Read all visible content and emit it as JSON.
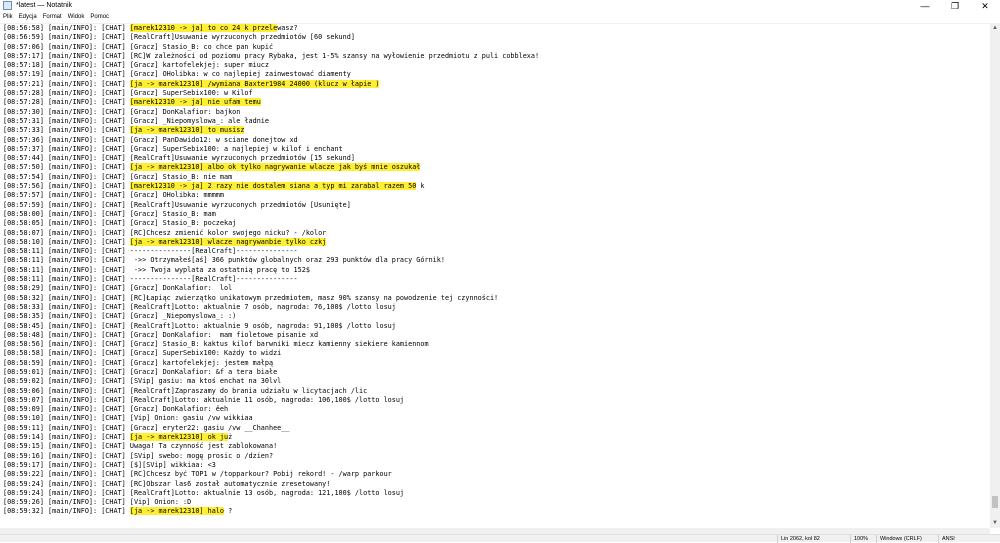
{
  "window": {
    "title": "*latest — Notatnik",
    "minimize_glyph": "—",
    "maximize_glyph": "❐",
    "close_glyph": "✕"
  },
  "menu": [
    "Plik",
    "Edycja",
    "Format",
    "Widok",
    "Pomoc"
  ],
  "lines": [
    {
      "pre": "[08:56:58] [main/INFO]: [CHAT] ",
      "hl": "[marek12310 -> ja] to co 24 k przele",
      "post": "wasz?"
    },
    {
      "pre": "[08:56:59] [main/INFO]: [CHAT] [RealCraft]Usuwanie wyrzuconych przedmiotów [60 sekund]",
      "hl": "",
      "post": ""
    },
    {
      "pre": "[08:57:06] [main/INFO]: [CHAT] [Gracz] Stasio_B: co chce pan kupić",
      "hl": "",
      "post": ""
    },
    {
      "pre": "[08:57:17] [main/INFO]: [CHAT] [RC]W zależności od poziomu pracy Rybaka, jest 1-5% szansy na wyłowienie przedmiotu z puli cobblexa!",
      "hl": "",
      "post": ""
    },
    {
      "pre": "[08:57:18] [main/INFO]: [CHAT] [Gracz] kartofelekjej: super miucz",
      "hl": "",
      "post": ""
    },
    {
      "pre": "[08:57:19] [main/INFO]: [CHAT] [Gracz] OHolibka: w co najlepiej zainwestować diamenty",
      "hl": "",
      "post": ""
    },
    {
      "pre": "[08:57:21] [main/INFO]: [CHAT] ",
      "hl": "[ja -> marek12310] /wymiana Baxter1984 24000 (klucz w łapie )",
      "post": ""
    },
    {
      "pre": "[08:57:28] [main/INFO]: [CHAT] [Gracz] SuperSebix100: w Kilof",
      "hl": "",
      "post": ""
    },
    {
      "pre": "[08:57:28] [main/INFO]: [CHAT] ",
      "hl": "[marek12310 -> ja] nie ufam temu",
      "post": ""
    },
    {
      "pre": "[08:57:30] [main/INFO]: [CHAT] [Gracz] DonKalafior: bajkon",
      "hl": "",
      "post": ""
    },
    {
      "pre": "[08:57:31] [main/INFO]: [CHAT] [Gracz] _Niepomyslowa_: ale ładnie",
      "hl": "",
      "post": ""
    },
    {
      "pre": "[08:57:33] [main/INFO]: [CHAT] ",
      "hl": "[ja -> marek12310] to musisz",
      "post": ""
    },
    {
      "pre": "[08:57:36] [main/INFO]: [CHAT] [Gracz] PanDawido12: w sciane donejtow xd",
      "hl": "",
      "post": ""
    },
    {
      "pre": "[08:57:37] [main/INFO]: [CHAT] [Gracz] SuperSebix100: a najlepiej w kilof i enchant",
      "hl": "",
      "post": ""
    },
    {
      "pre": "[08:57:44] [main/INFO]: [CHAT] [RealCraft]Usuwanie wyrzuconych przedmiotów [15 sekund]",
      "hl": "",
      "post": ""
    },
    {
      "pre": "[08:57:50] [main/INFO]: [CHAT] ",
      "hl": "[ja -> marek12310] albo ok tylko nagrywanie wlacze jak byś mnie oszukał",
      "post": ""
    },
    {
      "pre": "[08:57:54] [main/INFO]: [CHAT] [Gracz] Stasio_B: nie mam",
      "hl": "",
      "post": ""
    },
    {
      "pre": "[08:57:56] [main/INFO]: [CHAT] ",
      "hl": "[marek12310 -> ja] 2 razy nie dostalem siana a typ mi zarabal razem 50",
      "post": " k"
    },
    {
      "pre": "[08:57:57] [main/INFO]: [CHAT] [Gracz] OHolibka: mmmmm",
      "hl": "",
      "post": ""
    },
    {
      "pre": "[08:57:59] [main/INFO]: [CHAT] [RealCraft]Usuwanie wyrzuconych przedmiotów [Usunięte]",
      "hl": "",
      "post": ""
    },
    {
      "pre": "[08:58:00] [main/INFO]: [CHAT] [Gracz] Stasio_B: mam",
      "hl": "",
      "post": ""
    },
    {
      "pre": "[08:58:05] [main/INFO]: [CHAT] [Gracz] Stasio_B: poczekaj",
      "hl": "",
      "post": ""
    },
    {
      "pre": "[08:58:07] [main/INFO]: [CHAT] [RC]Chcesz zmienić kolor swojego nicku? - /kolor",
      "hl": "",
      "post": ""
    },
    {
      "pre": "[08:58:10] [main/INFO]: [CHAT] ",
      "hl": "[ja -> marek12310] wlacze nagrywanbie tylko czkj",
      "post": ""
    },
    {
      "pre": "[08:58:11] [main/INFO]: [CHAT] ---------------[RealCraft]---------------",
      "hl": "",
      "post": ""
    },
    {
      "pre": "[08:58:11] [main/INFO]: [CHAT]  ->> Otrzymałeś[aś] 366 punktów globalnych oraz 293 punktów dla pracy Górnik!",
      "hl": "",
      "post": ""
    },
    {
      "pre": "[08:58:11] [main/INFO]: [CHAT]  ->> Twoja wyplata za ostatnią pracę to 152$",
      "hl": "",
      "post": ""
    },
    {
      "pre": "[08:58:11] [main/INFO]: [CHAT] ---------------[RealCraft]---------------",
      "hl": "",
      "post": ""
    },
    {
      "pre": "[08:58:29] [main/INFO]: [CHAT] [Gracz] DonKalafior:  lol",
      "hl": "",
      "post": ""
    },
    {
      "pre": "[08:58:32] [main/INFO]: [CHAT] [RC]Łapiąc zwierzątko unikatowym przedmiotem, masz 90% szansy na powodzenie tej czynności!",
      "hl": "",
      "post": ""
    },
    {
      "pre": "[08:58:33] [main/INFO]: [CHAT] [RealCraft]Lotto: aktualnie 7 osób, nagroda: 76,100$ /lotto losuj",
      "hl": "",
      "post": ""
    },
    {
      "pre": "[08:58:35] [main/INFO]: [CHAT] [Gracz] _Niepomyslowa_: :)",
      "hl": "",
      "post": ""
    },
    {
      "pre": "[08:58:45] [main/INFO]: [CHAT] [RealCraft]Lotto: aktualnie 9 osób, nagroda: 91,100$ /lotto losuj",
      "hl": "",
      "post": ""
    },
    {
      "pre": "[08:58:48] [main/INFO]: [CHAT] [Gracz] DonKalafior:  mam fioletowe pisanie xd",
      "hl": "",
      "post": ""
    },
    {
      "pre": "[08:58:56] [main/INFO]: [CHAT] [Gracz] Stasio_B: kaktus kilof barwniki miecz kamienny siekiere kamiennom",
      "hl": "",
      "post": ""
    },
    {
      "pre": "[08:58:58] [main/INFO]: [CHAT] [Gracz] SuperSebix100: Każdy to widzi",
      "hl": "",
      "post": ""
    },
    {
      "pre": "[08:58:59] [main/INFO]: [CHAT] [Gracz] kartofelekjej: jestem małpą",
      "hl": "",
      "post": ""
    },
    {
      "pre": "[08:59:01] [main/INFO]: [CHAT] [Gracz] DonKalafior: &f a tera białe",
      "hl": "",
      "post": ""
    },
    {
      "pre": "[08:59:02] [main/INFO]: [CHAT] [SVip] gasiu: ma ktoś enchat na 30lvl",
      "hl": "",
      "post": ""
    },
    {
      "pre": "[08:59:06] [main/INFO]: [CHAT] [RealCraft]Zapraszamy do brania udziału w licytacjach /lic",
      "hl": "",
      "post": ""
    },
    {
      "pre": "[08:59:07] [main/INFO]: [CHAT] [RealCraft]Lotto: aktualnie 11 osób, nagroda: 106,100$ /lotto losuj",
      "hl": "",
      "post": ""
    },
    {
      "pre": "[08:59:09] [main/INFO]: [CHAT] [Gracz] DonKalafior: ěeh",
      "hl": "",
      "post": ""
    },
    {
      "pre": "[08:59:10] [main/INFO]: [CHAT] [Vip] Onion: gasiu /vw wikkiaa",
      "hl": "",
      "post": ""
    },
    {
      "pre": "[08:59:11] [main/INFO]: [CHAT] [Gracz] eryter22: gasiu /vw __Chanhee__",
      "hl": "",
      "post": ""
    },
    {
      "pre": "[08:59:14] [main/INFO]: [CHAT] ",
      "hl": "[ja -> marek12310] ok ju",
      "post": "ż"
    },
    {
      "pre": "[08:59:15] [main/INFO]: [CHAT] Uwaga! Ta czynność jest zablokowana!",
      "hl": "",
      "post": ""
    },
    {
      "pre": "[08:59:16] [main/INFO]: [CHAT] [SVip] swebo: mogę prosic o /dzien?",
      "hl": "",
      "post": ""
    },
    {
      "pre": "[08:59:17] [main/INFO]: [CHAT] [$][SVip] wikkiaa: <3",
      "hl": "",
      "post": ""
    },
    {
      "pre": "[08:59:22] [main/INFO]: [CHAT] [RC]Chcesz być TOP1 w /topparkour? Pobij rekord! - /warp parkour",
      "hl": "",
      "post": ""
    },
    {
      "pre": "[08:59:24] [main/INFO]: [CHAT] [RC]Obszar las6 został automatycznie zresetowany!",
      "hl": "",
      "post": ""
    },
    {
      "pre": "[08:59:24] [main/INFO]: [CHAT] [RealCraft]Lotto: aktualnie 13 osób, nagroda: 121,100$ /lotto losuj",
      "hl": "",
      "post": ""
    },
    {
      "pre": "[08:59:26] [main/INFO]: [CHAT] [Vip] Onion: :D",
      "hl": "",
      "post": ""
    },
    {
      "pre": "[08:59:32] [main/INFO]: [CHAT] ",
      "hl": "[ja -> marek12310] halo",
      "post": " ?"
    }
  ],
  "status": {
    "position": "Lin 2062, kol 82",
    "zoom": "100%",
    "line_ending": "Windows (CRLF)",
    "encoding": "ANSI"
  }
}
